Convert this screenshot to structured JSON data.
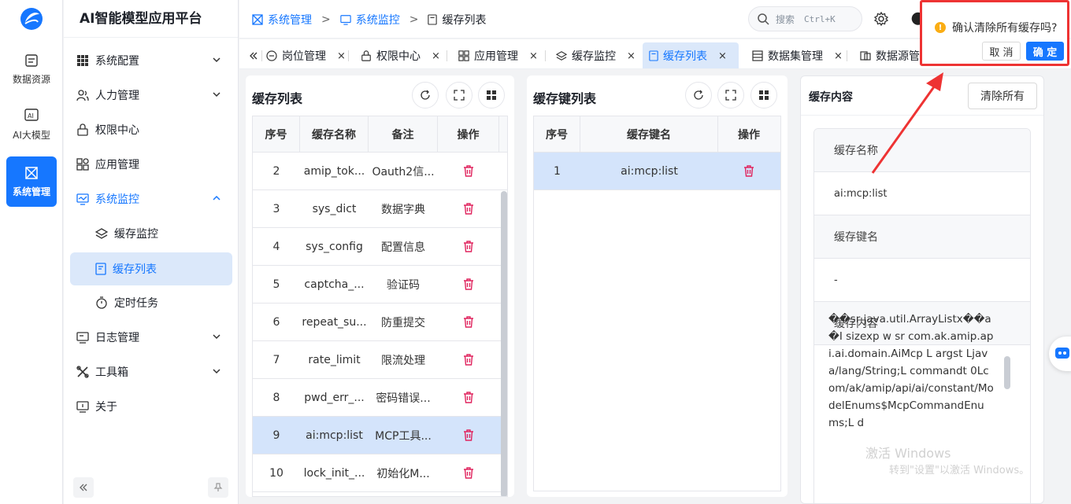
{
  "colors": {
    "accent": "#1677ff",
    "danger": "#e0245e",
    "selected_bg": "#dbe8fa",
    "annotation": "#ee3333"
  },
  "rail": [
    {
      "label": "数据资源",
      "icon": "database-icon"
    },
    {
      "label": "AI大模型",
      "icon": "ai-model-icon"
    },
    {
      "label": "系统管理",
      "icon": "system-icon",
      "active": true
    }
  ],
  "brand": "AI智能模型应用平台",
  "menu": {
    "system_config": "系统配置",
    "hr": "人力管理",
    "permission": "权限中心",
    "app": "应用管理",
    "monitor": "系统监控",
    "cache_monitor": "缓存监控",
    "cache_list": "缓存列表",
    "timer": "定时任务",
    "log": "日志管理",
    "toolbox": "工具箱",
    "about": "关于"
  },
  "breadcrumb": [
    "系统管理",
    "系统监控",
    "缓存列表"
  ],
  "search": {
    "placeholder": "搜索",
    "shortcut": "Ctrl+K"
  },
  "tabs": {
    "post": "岗位管理",
    "perm": "权限中心",
    "app": "应用管理",
    "cache_mon": "缓存监控",
    "cache_list": "缓存列表",
    "dataset": "数据集管理",
    "datasource": "数据源管理",
    "close": "×"
  },
  "cache_list": {
    "title": "缓存列表",
    "columns": [
      "序号",
      "缓存名称",
      "备注",
      "操作"
    ],
    "rows": [
      {
        "no": "2",
        "name": "amip_tok...",
        "remark": "Oauth2信..."
      },
      {
        "no": "3",
        "name": "sys_dict",
        "remark": "数据字典"
      },
      {
        "no": "4",
        "name": "sys_config",
        "remark": "配置信息"
      },
      {
        "no": "5",
        "name": "captcha_...",
        "remark": "验证码"
      },
      {
        "no": "6",
        "name": "repeat_su...",
        "remark": "防重提交"
      },
      {
        "no": "7",
        "name": "rate_limit",
        "remark": "限流处理"
      },
      {
        "no": "8",
        "name": "pwd_err_...",
        "remark": "密码错误..."
      },
      {
        "no": "9",
        "name": "ai:mcp:list",
        "remark": "MCP工具...",
        "selected": true
      },
      {
        "no": "10",
        "name": "lock_init_...",
        "remark": "初始化M..."
      }
    ]
  },
  "key_list": {
    "title": "缓存键列表",
    "columns": [
      "序号",
      "缓存键名",
      "操作"
    ],
    "rows": [
      {
        "no": "1",
        "key": "ai:mcp:list",
        "selected": true
      }
    ]
  },
  "detail": {
    "title": "缓存内容",
    "clear_label": "清除所有",
    "name_label": "缓存名称",
    "name_value": "ai:mcp:list",
    "key_label": "缓存键名",
    "key_value": "-",
    "content_label": "缓存内容",
    "content_value": "��sr java.util.ArrayListx��a�I sizexp w sr com.ak.amip.api.ai.domain.AiMcp L argst Ljava/lang/String;L commandt 0Lcom/ak/amip/api/ai/constant/ModelEnums$McpCommandEnums;L d"
  },
  "watermark": {
    "line1": "激活 Windows",
    "line2": "转到\"设置\"以激活 Windows。"
  },
  "popconfirm": {
    "message": "确认清除所有缓存吗?",
    "cancel": "取 消",
    "ok": "确 定"
  }
}
